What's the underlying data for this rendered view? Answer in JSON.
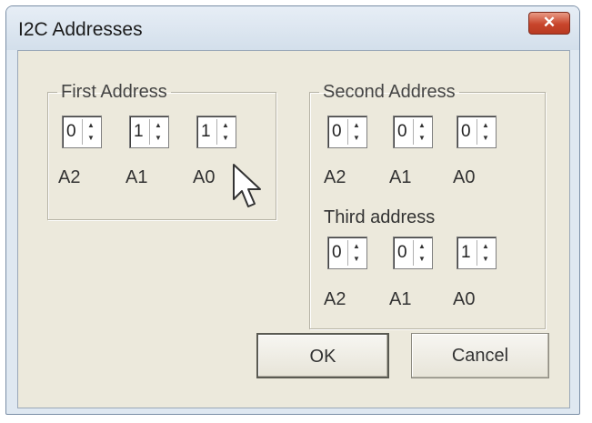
{
  "window": {
    "title": "I2C Addresses",
    "close_label": "x"
  },
  "first_group": {
    "legend": "First Address",
    "spinners": [
      {
        "value": "0"
      },
      {
        "value": "1"
      },
      {
        "value": "1"
      }
    ],
    "labels": [
      "A2",
      "A1",
      "A0"
    ]
  },
  "second_group": {
    "legend": "Second Address",
    "spinners": [
      {
        "value": "0"
      },
      {
        "value": "0"
      },
      {
        "value": "0"
      }
    ],
    "labels": [
      "A2",
      "A1",
      "A0"
    ],
    "third_heading": "Third address",
    "third_spinners": [
      {
        "value": "0"
      },
      {
        "value": "0"
      },
      {
        "value": "1"
      }
    ],
    "third_labels": [
      "A2",
      "A1",
      "A0"
    ]
  },
  "buttons": {
    "ok": "OK",
    "cancel": "Cancel"
  },
  "icons": {
    "spinner_arrows": "up-down-arrow-icon",
    "cursor": "mouse-pointer-icon",
    "close": "close-icon"
  }
}
